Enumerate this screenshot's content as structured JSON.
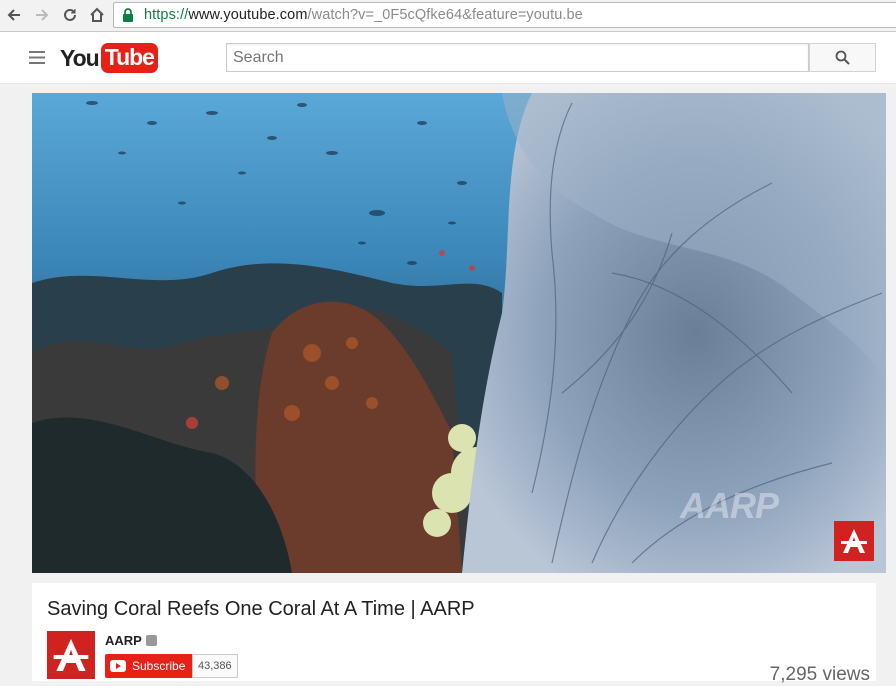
{
  "browser": {
    "url_scheme": "https://",
    "url_host": "www.youtube.com",
    "url_path": "/watch?v=_0F5cQfke64&feature=youtu.be"
  },
  "header": {
    "logo_you": "You",
    "logo_tube": "Tube",
    "search_placeholder": "Search"
  },
  "player": {
    "watermark": "AARP",
    "corner_logo": "A"
  },
  "video": {
    "title": "Saving Coral Reefs One Coral At A Time | AARP",
    "channel": "AARP",
    "avatar_letter": "A",
    "subscribe_label": "Subscribe",
    "subscriber_count": "43,386",
    "views": "7,295 views"
  },
  "colors": {
    "brand_red": "#e62117",
    "aarp_red": "#d12222",
    "secure_green": "#0b8043"
  }
}
